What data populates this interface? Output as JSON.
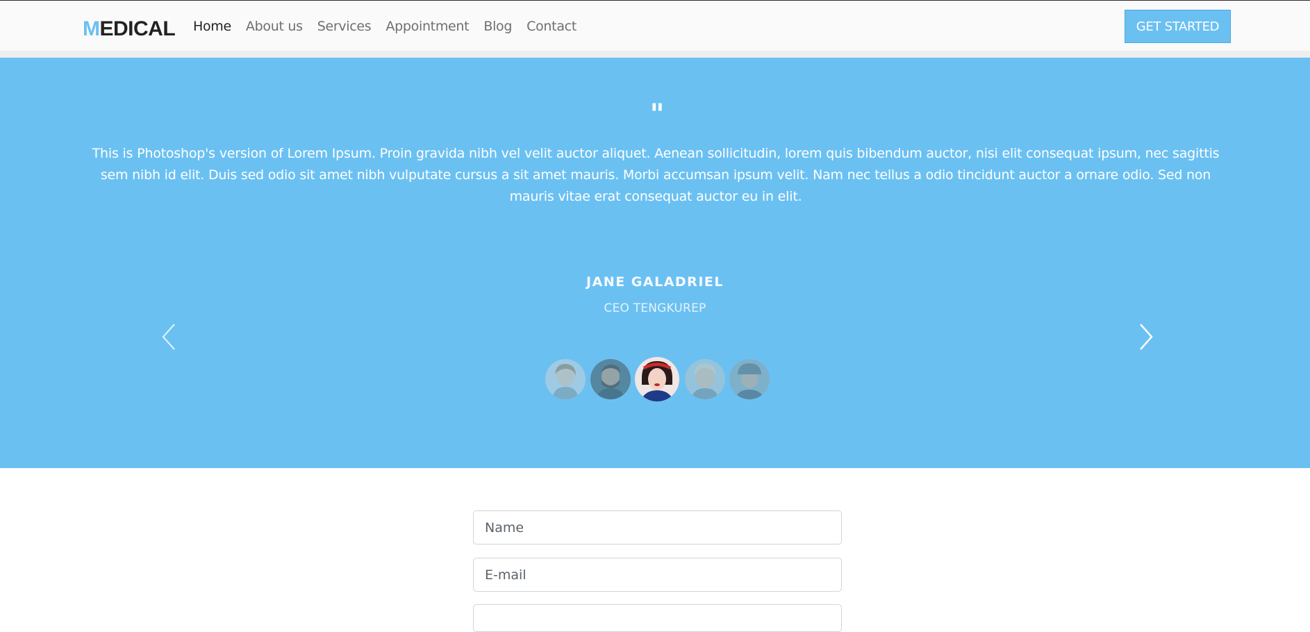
{
  "header": {
    "logo_first": "M",
    "logo_rest": "EDICAL",
    "nav": [
      {
        "label": "Home",
        "active": true
      },
      {
        "label": "About us"
      },
      {
        "label": "Services"
      },
      {
        "label": "Appointment"
      },
      {
        "label": "Blog"
      },
      {
        "label": "Contact"
      }
    ],
    "cta_label": "GET STARTED"
  },
  "testimonial": {
    "quote_mark": "\"",
    "text": "This is Photoshop's version of Lorem Ipsum. Proin gravida nibh vel velit auctor aliquet. Aenean sollicitudin, lorem quis bibendum auctor, nisi elit consequat ipsum, nec sagittis sem nibh id elit. Duis sed odio sit amet nibh vulputate cursus a sit amet mauris. Morbi accumsan ipsum velit. Nam nec tellus a odio tincidunt auctor a ornare odio. Sed non mauris vitae erat consequat auctor eu in elit.",
    "author_name": "JANE GALADRIEL",
    "author_title": "CEO TENGKUREP",
    "active_index": 2
  },
  "form": {
    "name_placeholder": "Name",
    "email_placeholder": "E-mail"
  },
  "colors": {
    "accent": "#6bc0f2",
    "header_bg": "#fafafa",
    "text_dark": "#222222",
    "nav_text": "#6f6f6f"
  }
}
